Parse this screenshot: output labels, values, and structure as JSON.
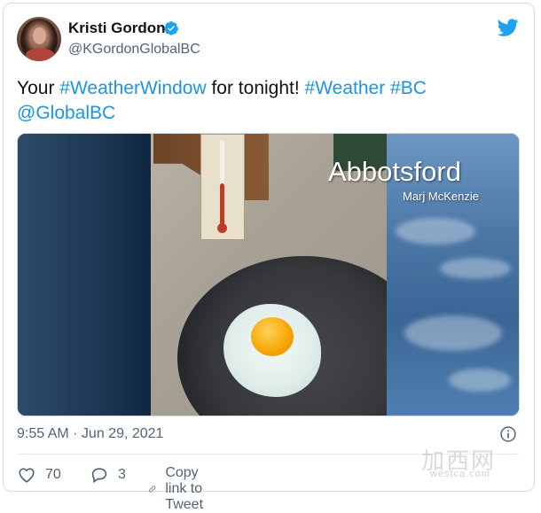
{
  "tweet": {
    "author_name": "Kristi Gordon",
    "author_handle": "@KGordonGlobalBC",
    "text_parts": [
      "Your ",
      "#WeatherWindow",
      " for tonight! ",
      "#Weather",
      " ",
      "#BC",
      " ",
      "@GlobalBC"
    ],
    "timestamp": "9:55 AM · Jun 29, 2021"
  },
  "media": {
    "overlay_title": "Abbotsford",
    "overlay_credit": "Marj McKenzie"
  },
  "actions": {
    "likes_count": "70",
    "replies_count": "3",
    "copy_link_label": "Copy link to Tweet"
  },
  "watermark": {
    "main": "加西网",
    "site": "westca.com"
  },
  "colors": {
    "link": "#1b95e0",
    "brand": "#1da1f2",
    "muted": "#536471"
  },
  "icons": [
    "verified-badge-icon",
    "twitter-bird-icon",
    "info-icon",
    "heart-icon",
    "reply-icon",
    "link-icon"
  ]
}
